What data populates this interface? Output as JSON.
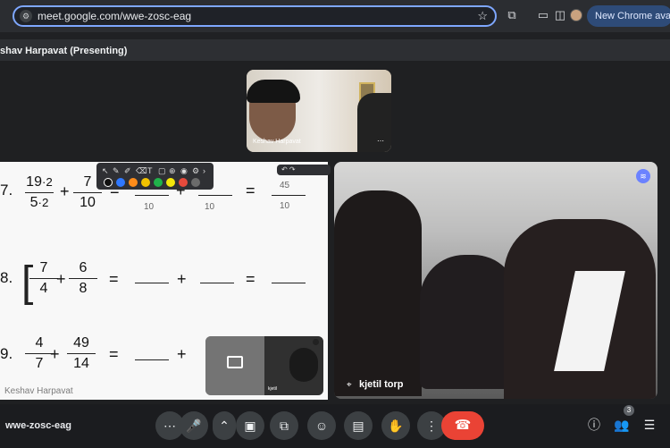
{
  "browser": {
    "url": "meet.google.com/wwe-zosc-eag",
    "update_label": "New Chrome available",
    "url_icon": "site-info-icon",
    "star_icon": "star-icon"
  },
  "presenting": {
    "banner": "shav Harpavat (Presenting)"
  },
  "meeting": {
    "code": "wwe-zosc-eag",
    "participants_count": "3"
  },
  "tiles": {
    "top_name": "Keshav Harpavat",
    "right_name": "kjetil torp",
    "self_label": "kjetil",
    "self_present_label": "",
    "screen_owner": "Keshav Harpavat"
  },
  "math": {
    "rows": [
      {
        "index": "7.",
        "a_num": "19",
        "a_num_mult": "·2",
        "a_den": "5",
        "a_den_mult": "·2",
        "b_num": "7",
        "b_den": "10",
        "blank1": "10",
        "blank2": "10",
        "result_num": "45",
        "result_den": "10"
      },
      {
        "index": "8.",
        "a_num": "7",
        "a_den": "4",
        "b_num": "6",
        "b_den": "8"
      },
      {
        "index": "9.",
        "a_num": "4",
        "a_den": "7",
        "b_num": "49",
        "b_den": "14"
      }
    ]
  },
  "toolbar_colors": [
    "#2f78ff",
    "#ff8c1a",
    "#f2c300",
    "#20b34a",
    "#f4e60b",
    "#e64a3c",
    "#6b6b6b"
  ],
  "bottom_bar": {
    "buttons": [
      "more-icon",
      "mic-icon",
      "caret-icon",
      "camera-icon",
      "present-icon",
      "emoji-icon",
      "captions-icon",
      "raise-hand-icon",
      "more-vertical-icon",
      "end-call-icon"
    ],
    "right": [
      "info-icon",
      "people-icon",
      "chat-icon"
    ]
  }
}
